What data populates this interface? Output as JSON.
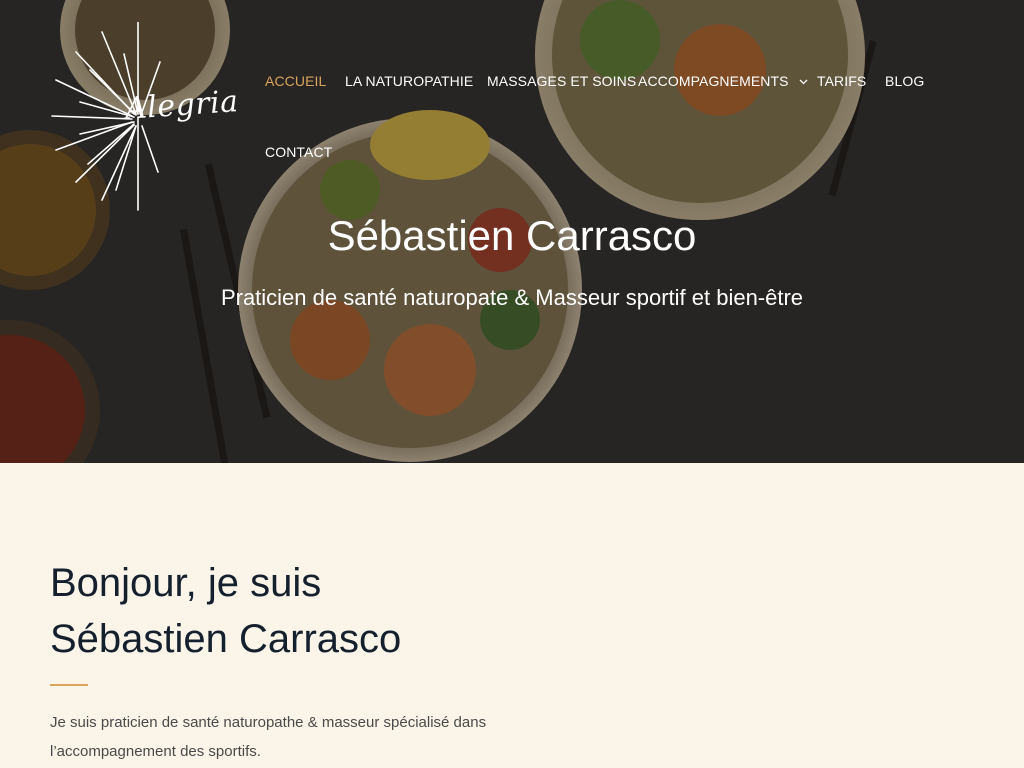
{
  "brand": {
    "logo_text": "Alegria"
  },
  "nav": {
    "items": [
      {
        "label": "ACCUEIL",
        "active": true
      },
      {
        "label": "LA NATUROPATHIE",
        "active": false
      },
      {
        "label": "MASSAGES ET SOINS",
        "active": false
      },
      {
        "label": "ACCOMPAGNEMENTS",
        "active": false,
        "has_dropdown": true
      },
      {
        "label": "TARIFS",
        "active": false
      },
      {
        "label": "BLOG",
        "active": false
      },
      {
        "label": "CONTACT",
        "active": false
      }
    ],
    "dropdown_icon": "chevron-down-icon"
  },
  "hero": {
    "title": "Sébastien Carrasco",
    "subtitle": "Praticien de santé naturopate & Masseur sportif et bien-être"
  },
  "about": {
    "heading_line1": "Bonjour, je suis",
    "heading_line2": "Sébastien Carrasco",
    "intro": "Je suis praticien de santé naturopathe & masseur spécialisé dans l’accompagnement des sportifs."
  },
  "colors": {
    "accent": "#d9a45b",
    "hero_dark": "#2f2d2b",
    "content_bg": "#faf5e8",
    "heading": "#15202f",
    "body_text": "#4a4a4a"
  }
}
